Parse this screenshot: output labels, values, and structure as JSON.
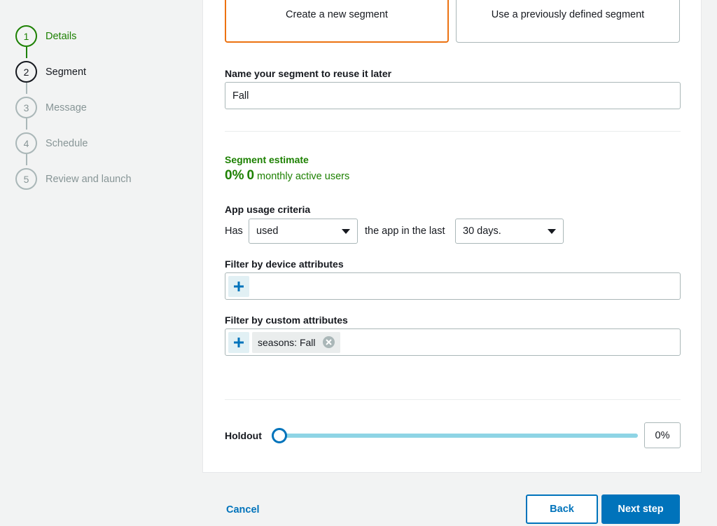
{
  "stepper": {
    "steps": [
      {
        "number": "1",
        "label": "Details",
        "state": "done"
      },
      {
        "number": "2",
        "label": "Segment",
        "state": "current"
      },
      {
        "number": "3",
        "label": "Message",
        "state": "upcoming"
      },
      {
        "number": "4",
        "label": "Schedule",
        "state": "upcoming"
      },
      {
        "number": "5",
        "label": "Review and launch",
        "state": "upcoming"
      }
    ]
  },
  "segment_choice": {
    "new_label": "Create a new segment",
    "existing_label": "Use a previously defined segment",
    "selected": "new"
  },
  "segment_name": {
    "label": "Name your segment to reuse it later",
    "value": "Fall"
  },
  "estimate": {
    "title": "Segment estimate",
    "percent": "0%",
    "count": "0",
    "suffix": "monthly active users"
  },
  "app_usage": {
    "label": "App usage criteria",
    "prefix": "Has",
    "usage_value": "used",
    "middle": "the app in the last",
    "period_value": "30 days."
  },
  "device_filter": {
    "label": "Filter by device attributes"
  },
  "custom_filter": {
    "label": "Filter by custom attributes",
    "token_key": "seasons:",
    "token_value": "Fall"
  },
  "holdout": {
    "label": "Holdout",
    "value_text": "0%",
    "level": 0
  },
  "footer": {
    "cancel": "Cancel",
    "back": "Back",
    "next": "Next step"
  },
  "colors": {
    "accent_orange": "#ec7211",
    "success_green": "#1d8102",
    "link_blue": "#0073bb",
    "slider_blue": "#8ed4e5"
  }
}
